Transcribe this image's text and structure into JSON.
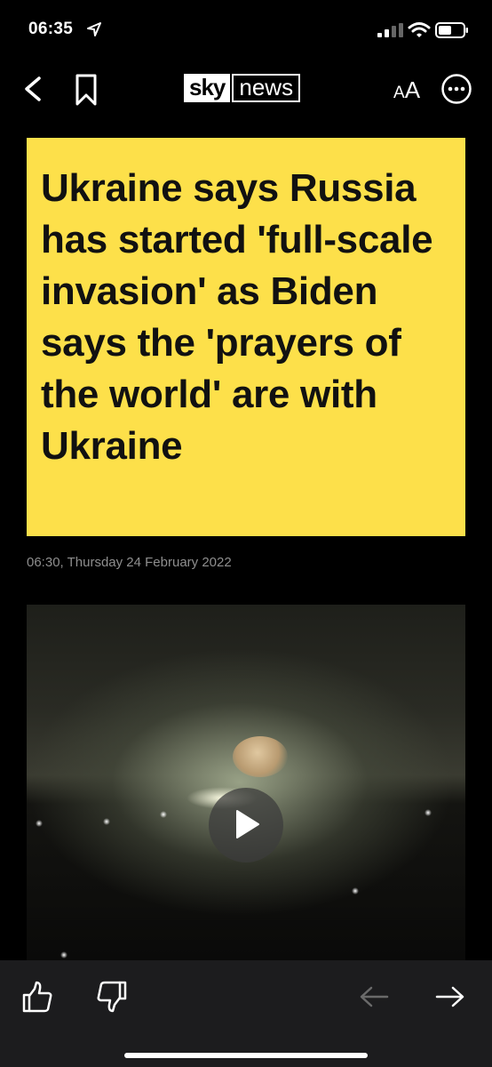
{
  "status": {
    "time": "06:35",
    "icons": [
      "location-arrow-icon",
      "signal-icon",
      "wifi-icon",
      "battery-icon"
    ]
  },
  "nav": {
    "logo_sky": "sky",
    "logo_news": "news",
    "text_size_label_small": "A",
    "text_size_label_large": "A",
    "icons": [
      "back-chevron-icon",
      "bookmark-icon",
      "more-icon"
    ]
  },
  "article": {
    "headline": "Ukraine says Russia has started 'full-scale invasion' as Biden says the 'prayers of the world' are with Ukraine",
    "timestamp": "06:30, Thursday 24 February 2022"
  },
  "video": {
    "play_icon": "play-icon"
  },
  "bottom_bar": {
    "icons": [
      "thumbs-up-icon",
      "thumbs-down-icon",
      "arrow-left-icon",
      "arrow-right-icon"
    ]
  },
  "colors": {
    "headline_bg": "#fde04a",
    "headline_text": "#111111",
    "background": "#000000",
    "timestamp": "#8e8e8e",
    "bottom_bar_bg": "#1c1c1e",
    "prev_arrow_disabled": "#6a6a6a"
  }
}
